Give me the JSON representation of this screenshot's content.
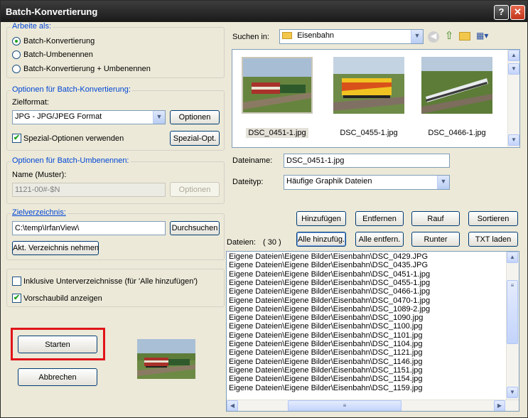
{
  "window": {
    "title": "Batch-Konvertierung",
    "help_btn": "?",
    "close_btn": "✕"
  },
  "work_as": {
    "label": "Arbeite als:",
    "options": [
      "Batch-Konvertierung",
      "Batch-Umbenennen",
      "Batch-Konvertierung + Umbenennen"
    ],
    "selected": 0
  },
  "convert": {
    "group_label": "Optionen für Batch-Konvertierung:",
    "format_label": "Zielformat:",
    "format_value": "JPG - JPG/JPEG Format",
    "options_btn": "Optionen",
    "special_label": "Spezial-Optionen verwenden",
    "special_checked": true,
    "special_btn": "Spezial-Opt."
  },
  "rename": {
    "group_label": "Optionen für Batch-Umbenennen:",
    "pattern_label": "Name (Muster):",
    "pattern_value": "1121-00#-$N",
    "options_btn": "Optionen"
  },
  "target": {
    "group_label": "Zielverzeichnis:",
    "path": "C:\\temp\\IrfanView\\",
    "browse_btn": "Durchsuchen",
    "current_btn": "Akt. Verzeichnis nehmen"
  },
  "checks": {
    "subdirs": "Inklusive Unterverzeichnisse (für 'Alle hinzufügen')",
    "subdirs_checked": false,
    "preview": "Vorschaubild anzeigen",
    "preview_checked": true
  },
  "actions": {
    "start": "Starten",
    "cancel": "Abbrechen"
  },
  "browser": {
    "lookin_label": "Suchen in:",
    "folder": "Eisenbahn",
    "thumbnails": [
      "DSC_0451-1.jpg",
      "DSC_0455-1.jpg",
      "DSC_0466-1.jpg"
    ],
    "filename_label": "Dateiname:",
    "filename_value": "DSC_0451-1.jpg",
    "filetype_label": "Dateityp:",
    "filetype_value": "Häufige Graphik Dateien"
  },
  "list_buttons": {
    "add": "Hinzufügen",
    "remove": "Entfernen",
    "up": "Rauf",
    "sort": "Sortieren",
    "add_all": "Alle hinzufüg.",
    "remove_all": "Alle entfern.",
    "down": "Runter",
    "load_txt": "TXT laden"
  },
  "files": {
    "label": "Dateien:",
    "count": "( 30 )",
    "items": [
      "Eigene Dateien\\Eigene Bilder\\Eisenbahn\\DSC_0429.JPG",
      "Eigene Dateien\\Eigene Bilder\\Eisenbahn\\DSC_0435.JPG",
      "Eigene Dateien\\Eigene Bilder\\Eisenbahn\\DSC_0451-1.jpg",
      "Eigene Dateien\\Eigene Bilder\\Eisenbahn\\DSC_0455-1.jpg",
      "Eigene Dateien\\Eigene Bilder\\Eisenbahn\\DSC_0466-1.jpg",
      "Eigene Dateien\\Eigene Bilder\\Eisenbahn\\DSC_0470-1.jpg",
      "Eigene Dateien\\Eigene Bilder\\Eisenbahn\\DSC_1089-2.jpg",
      "Eigene Dateien\\Eigene Bilder\\Eisenbahn\\DSC_1090.jpg",
      "Eigene Dateien\\Eigene Bilder\\Eisenbahn\\DSC_1100.jpg",
      "Eigene Dateien\\Eigene Bilder\\Eisenbahn\\DSC_1101.jpg",
      "Eigene Dateien\\Eigene Bilder\\Eisenbahn\\DSC_1104.jpg",
      "Eigene Dateien\\Eigene Bilder\\Eisenbahn\\DSC_1121.jpg",
      "Eigene Dateien\\Eigene Bilder\\Eisenbahn\\DSC_1146.jpg",
      "Eigene Dateien\\Eigene Bilder\\Eisenbahn\\DSC_1151.jpg",
      "Eigene Dateien\\Eigene Bilder\\Eisenbahn\\DSC_1154.jpg",
      "Eigene Dateien\\Eigene Bilder\\Eisenbahn\\DSC_1159.jpg"
    ]
  },
  "colors": {
    "accent": "#0046d5",
    "highlight": "#e1141a"
  }
}
